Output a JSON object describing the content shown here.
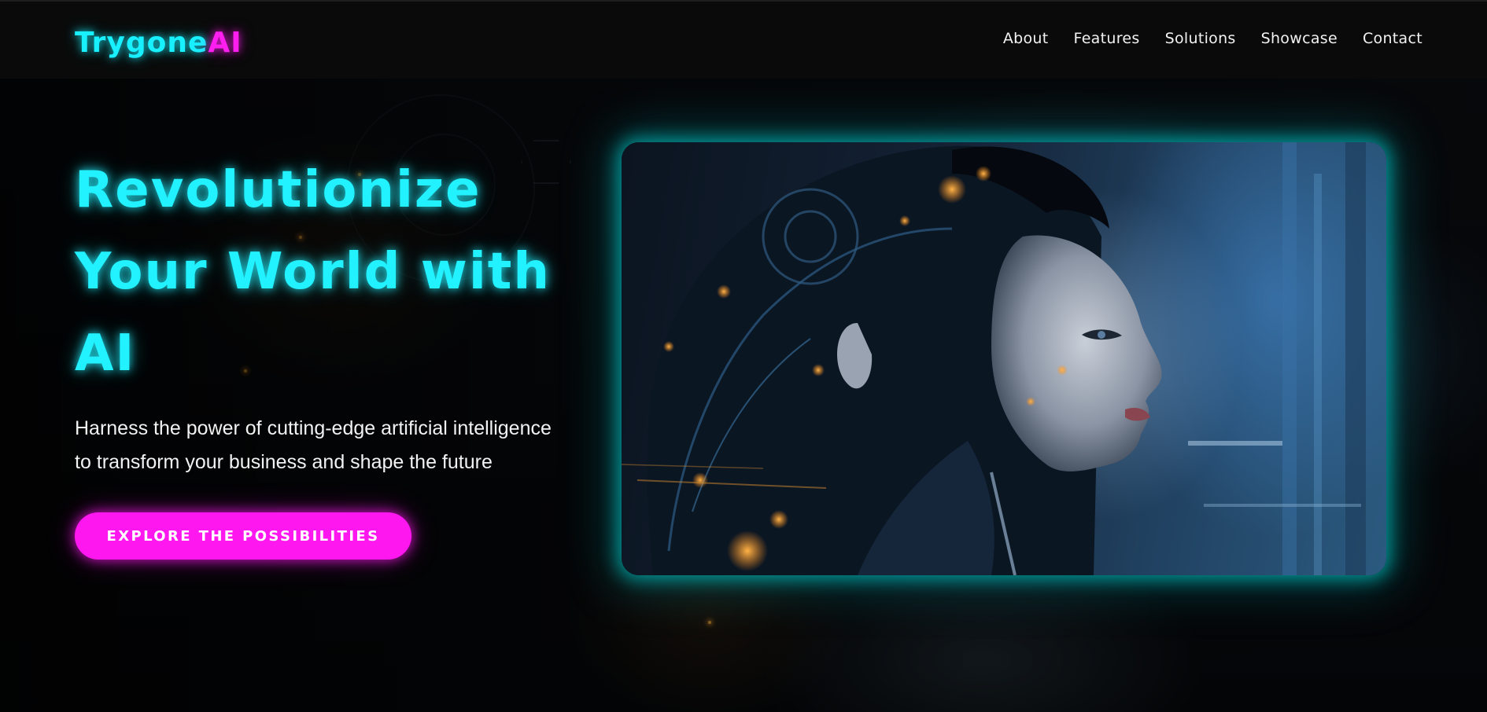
{
  "brand": {
    "part1": "Trygone",
    "part2": "AI"
  },
  "nav": {
    "items": [
      "About",
      "Features",
      "Solutions",
      "Showcase",
      "Contact"
    ]
  },
  "hero": {
    "title_lines": [
      "Revolutionize",
      "Your World with",
      "AI"
    ],
    "subtitle_lines": [
      "Harness the power of cutting-edge artificial intelligence",
      "to transform your business and shape the future"
    ],
    "cta_label": "EXPLORE THE POSSIBILITIES",
    "image_alt": "futuristic cyborg woman profile"
  },
  "colors": {
    "accent_cyan": "#22f2ff",
    "accent_magenta": "#ff17f0",
    "header_bg": "#0a0a0a"
  }
}
